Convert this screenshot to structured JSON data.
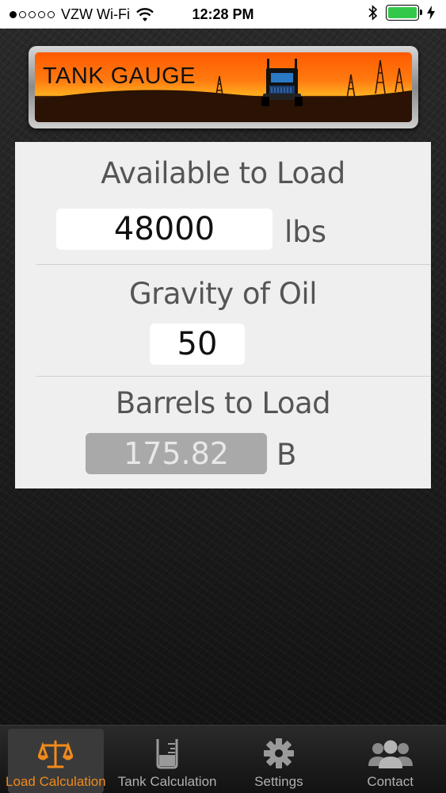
{
  "status_bar": {
    "carrier": "VZW Wi-Fi",
    "time": "12:28 PM",
    "signal_bars_filled": 1,
    "signal_bars_total": 5,
    "battery_level": 1.0
  },
  "banner": {
    "title": "TANK GAUGE"
  },
  "form": {
    "available_label": "Available to Load",
    "available_value": "48000",
    "available_unit": "lbs",
    "gravity_label": "Gravity of Oil",
    "gravity_value": "50",
    "barrels_label": "Barrels to Load",
    "barrels_value": "175.82",
    "barrels_unit": "B"
  },
  "tabs": [
    {
      "label": "Load Calculation",
      "icon": "scale-icon",
      "active": true
    },
    {
      "label": "Tank Calculation",
      "icon": "beaker-icon",
      "active": false
    },
    {
      "label": "Settings",
      "icon": "gear-icon",
      "active": false
    },
    {
      "label": "Contact",
      "icon": "contacts-icon",
      "active": false
    }
  ],
  "colors": {
    "accent": "#f08a1c",
    "battery": "#34c84a",
    "panel": "#efefef",
    "readonly_field": "#a9a9a9"
  }
}
